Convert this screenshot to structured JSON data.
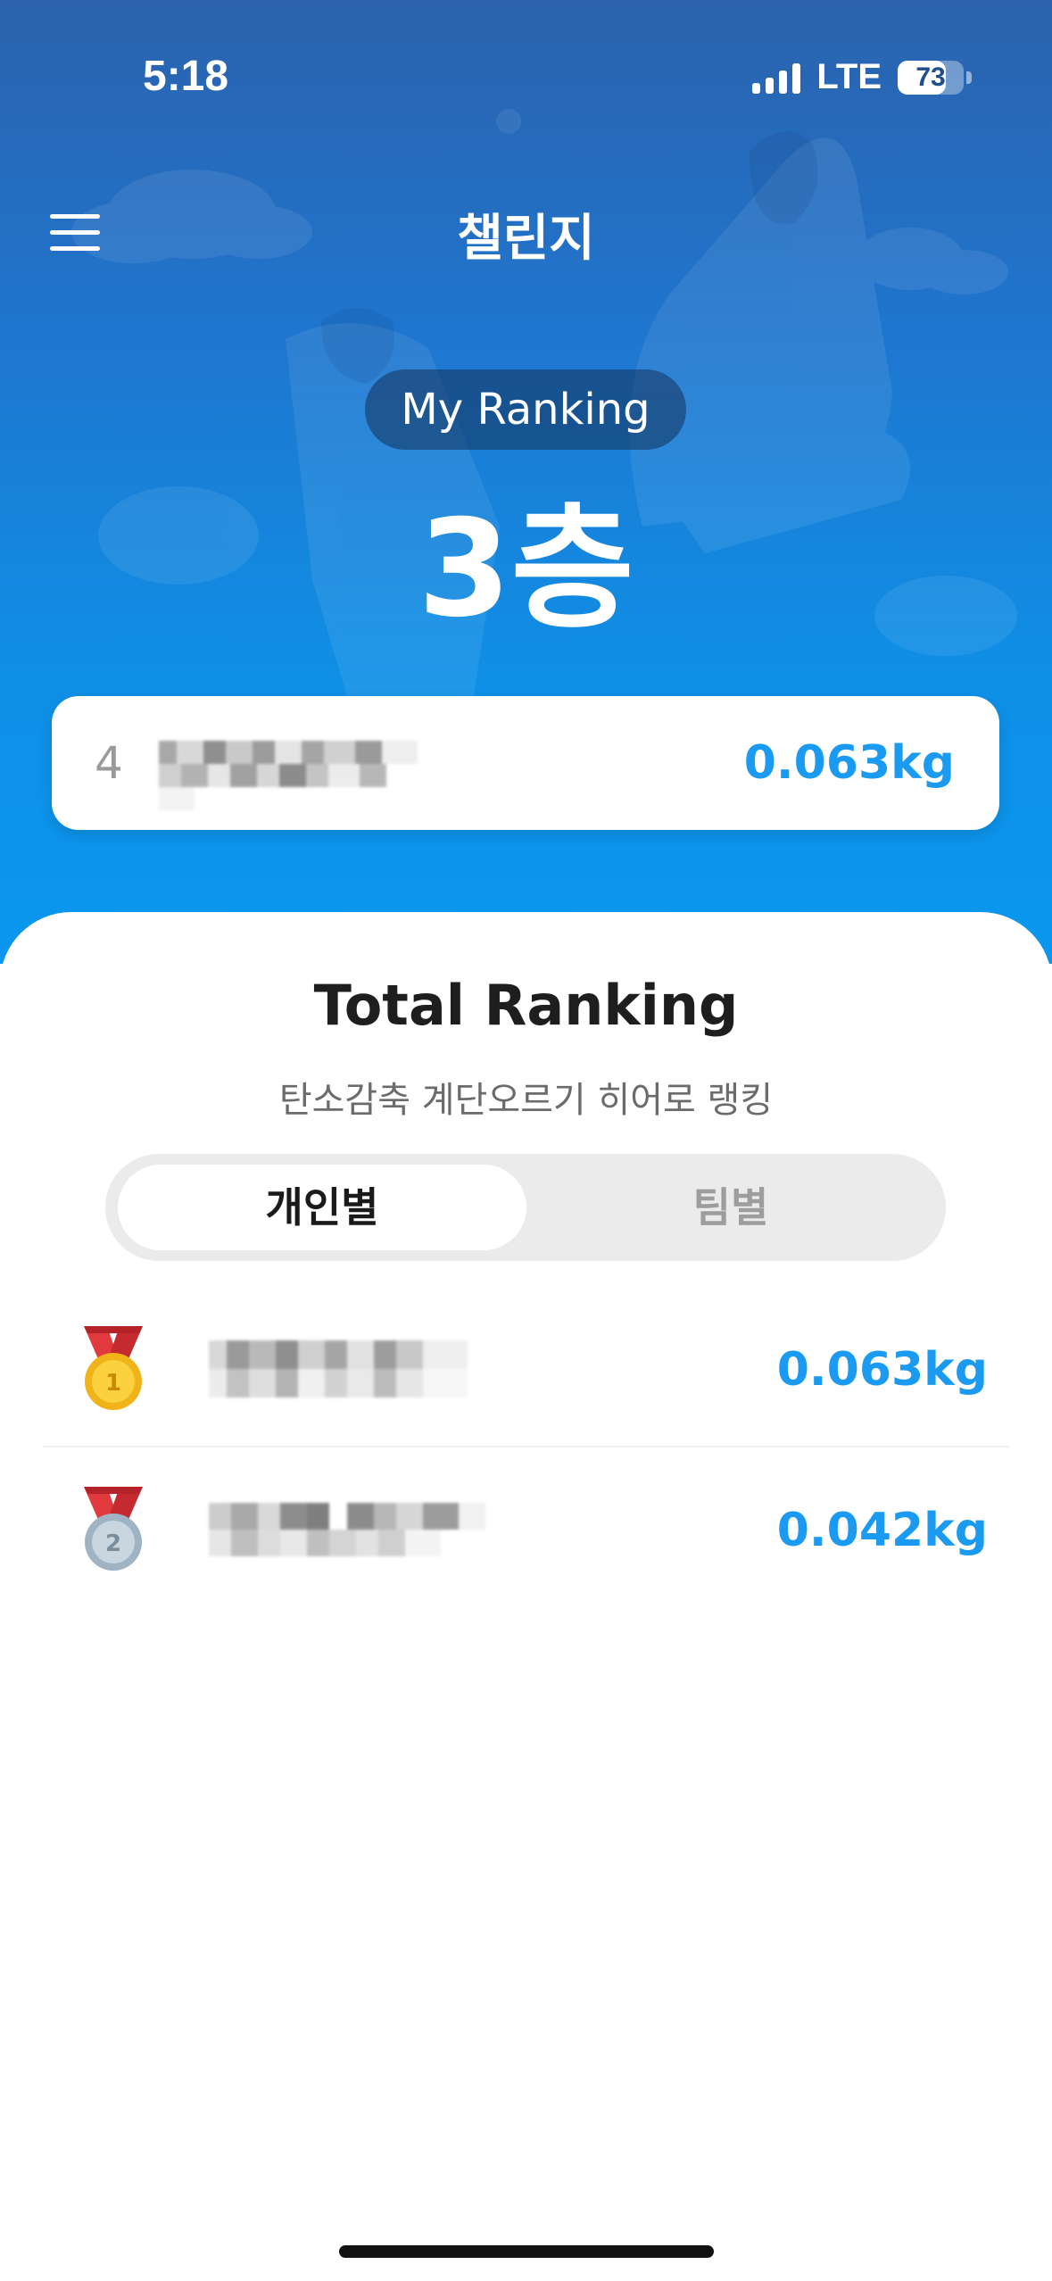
{
  "status_bar": {
    "time": "5:18",
    "network": "LTE",
    "battery_level": "73",
    "signal_icon": "signal-bars-icon",
    "battery_icon": "battery-icon"
  },
  "header": {
    "title": "챌린지",
    "menu_icon": "hamburger-menu-icon"
  },
  "my_ranking": {
    "label": "My Ranking",
    "floor": "3층",
    "rank": "4",
    "value": "0.063kg"
  },
  "total_ranking": {
    "title": "Total Ranking",
    "subtitle": "탄소감축 계단오르기 히어로 랭킹",
    "tabs": [
      {
        "label": "개인별",
        "selected": true
      },
      {
        "label": "팀별",
        "selected": false
      }
    ],
    "rows": [
      {
        "medal": "gold-medal-icon",
        "medal_number": "1",
        "value": "0.063kg"
      },
      {
        "medal": "silver-medal-icon",
        "medal_number": "2",
        "value": "0.042kg"
      }
    ]
  },
  "colors": {
    "accent": "#1a9af0",
    "hero_top": "#2b62ad",
    "hero_bottom": "#0a97ef"
  }
}
